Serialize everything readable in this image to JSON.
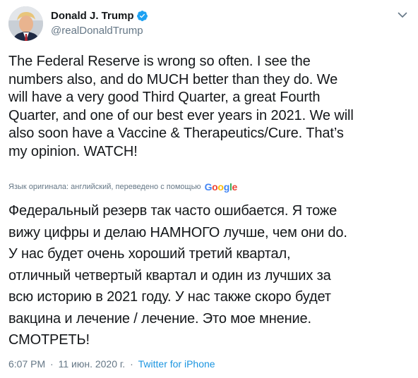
{
  "user": {
    "display_name": "Donald J. Trump",
    "handle": "@realDonaldTrump",
    "verified_icon": "verified-badge-icon",
    "avatar": "profile-photo"
  },
  "tweet": {
    "text": "The Federal Reserve is wrong so often. I see the\nnumbers also, and do MUCH better than they do. We\nwill have a very good Third Quarter, a great Fourth\nQuarter, and one of our best ever years in 2021. We will\nalso soon have a Vaccine & Therapeutics/Cure. That’s\nmy opinion. WATCH!",
    "translation_note": "Язык оригинала: английский, переведено с помощью",
    "translation_provider": "Google",
    "translated_text": "Федеральный резерв так часто ошибается. Я тоже\nвижу цифры и делаю НАМНОГО лучше, чем они do.\nУ нас будет очень хороший третий квартал,\nотличный четвертый квартал и один из лучших за\nвсю историю в 2021 году. У нас также скоро будет\nвакцина и лечение / лечение. Это мое мнение.\nСМОТРЕТЬ!"
  },
  "meta": {
    "time": "6:07 PM",
    "separator": "·",
    "date": "11 июн. 2020 г.",
    "source": "Twitter for iPhone"
  },
  "colors": {
    "text": "#14171a",
    "secondary": "#657786",
    "link": "#1b95e0",
    "verified": "#1da1f2",
    "google_blue": "#4285F4",
    "google_red": "#EA4335",
    "google_yellow": "#FBBC05",
    "google_green": "#34A853"
  },
  "icons": {
    "menu": "chevron-down-icon"
  }
}
